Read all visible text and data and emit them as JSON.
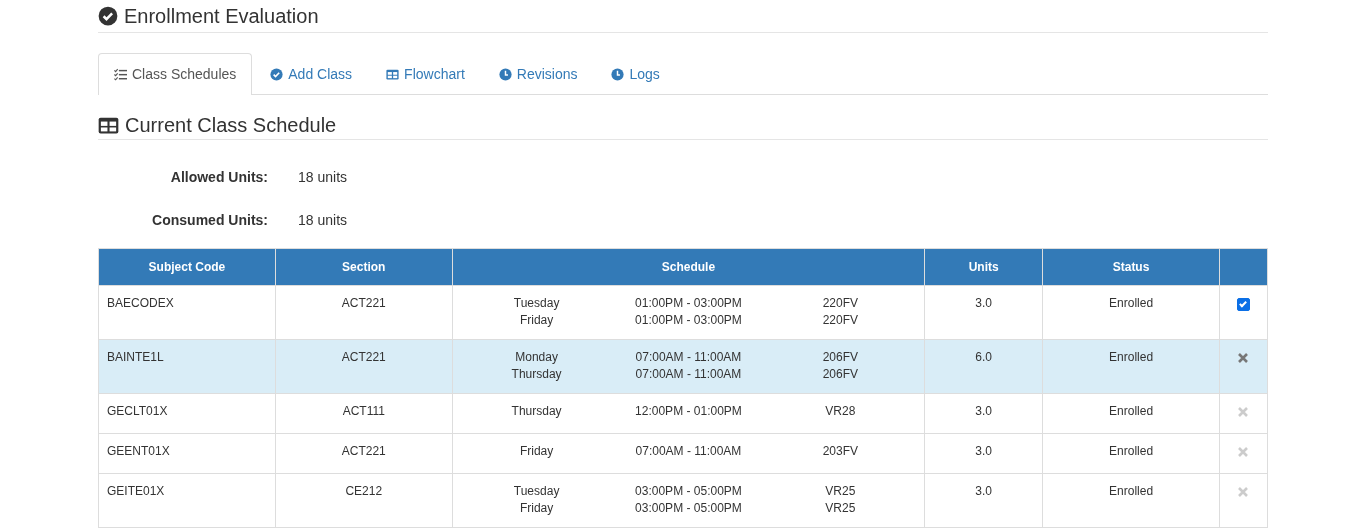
{
  "page_title": "Enrollment Evaluation",
  "tabs": [
    {
      "label": "Class Schedules",
      "selected": true
    },
    {
      "label": "Add Class",
      "selected": false
    },
    {
      "label": "Flowchart",
      "selected": false
    },
    {
      "label": "Revisions",
      "selected": false
    },
    {
      "label": "Logs",
      "selected": false
    }
  ],
  "section_title": "Current Class Schedule",
  "summary": [
    {
      "label": "Allowed Units:",
      "value": "18 units"
    },
    {
      "label": "Consumed Units:",
      "value": "18 units"
    }
  ],
  "table": {
    "columns": [
      "Subject Code",
      "Section",
      "Schedule",
      "Units",
      "Status"
    ],
    "rows": [
      {
        "subject_code": "BAECODEX",
        "section": "ACT221",
        "schedule": [
          {
            "day": "Tuesday",
            "time": "01:00PM - 03:00PM",
            "room": "220FV"
          },
          {
            "day": "Friday",
            "time": "01:00PM - 03:00PM",
            "room": "220FV"
          }
        ],
        "units": "3.0",
        "status": "Enrolled",
        "selected": false,
        "action": {
          "kind": "checkbox",
          "checked": true
        }
      },
      {
        "subject_code": "BAINTE1L",
        "section": "ACT221",
        "schedule": [
          {
            "day": "Monday",
            "time": "07:00AM - 11:00AM",
            "room": "206FV"
          },
          {
            "day": "Thursday",
            "time": "07:00AM - 11:00AM",
            "room": "206FV"
          }
        ],
        "units": "6.0",
        "status": "Enrolled",
        "selected": true,
        "action": {
          "kind": "remove"
        }
      },
      {
        "subject_code": "GECLT01X",
        "section": "ACT111",
        "schedule": [
          {
            "day": "Thursday",
            "time": "12:00PM - 01:00PM",
            "room": "VR28"
          }
        ],
        "units": "3.0",
        "status": "Enrolled",
        "selected": false,
        "action": {
          "kind": "remove"
        }
      },
      {
        "subject_code": "GEENT01X",
        "section": "ACT221",
        "schedule": [
          {
            "day": "Friday",
            "time": "07:00AM - 11:00AM",
            "room": "203FV"
          }
        ],
        "units": "3.0",
        "status": "Enrolled",
        "selected": false,
        "action": {
          "kind": "remove"
        }
      },
      {
        "subject_code": "GEITE01X",
        "section": "CE212",
        "schedule": [
          {
            "day": "Tuesday",
            "time": "03:00PM - 05:00PM",
            "room": "VR25"
          },
          {
            "day": "Friday",
            "time": "03:00PM - 05:00PM",
            "room": "VR25"
          }
        ],
        "units": "3.0",
        "status": "Enrolled",
        "selected": false,
        "action": {
          "kind": "remove"
        }
      }
    ]
  }
}
